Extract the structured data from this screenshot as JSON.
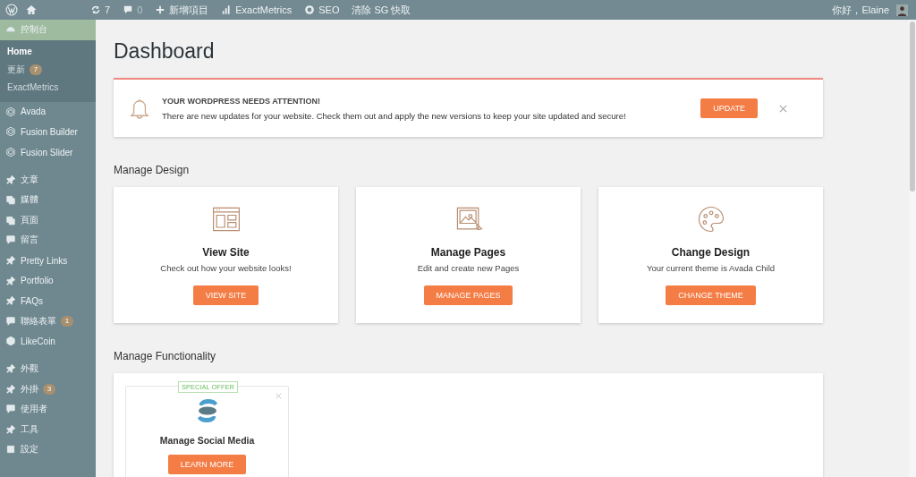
{
  "admin_bar": {
    "updates": "7",
    "comments": "0",
    "new_label": "新增項目",
    "analytics_label": "ExactMetrics",
    "seo_label": "SEO",
    "cache_label": "清除 SG 快取",
    "greeting": "你好，Elaine"
  },
  "sidebar": {
    "groups": [
      {
        "items": [
          {
            "label": "控制台",
            "selected": true,
            "submenu": [
              {
                "label": "Home",
                "selected": true
              },
              {
                "label": "更新",
                "selected": false,
                "badge": "7"
              },
              {
                "label": "ExactMetrics",
                "selected": false
              }
            ]
          }
        ]
      },
      {
        "items": [
          {
            "label": "Avada",
            "selected": false
          },
          {
            "label": "Fusion Builder",
            "selected": false
          },
          {
            "label": "Fusion Slider",
            "selected": false
          }
        ]
      },
      {
        "items": [
          {
            "label": "文章",
            "selected": false
          },
          {
            "label": "媒體",
            "selected": false
          },
          {
            "label": "頁面",
            "selected": false
          },
          {
            "label": "留言",
            "selected": false
          },
          {
            "label": "Pretty Links",
            "selected": false
          },
          {
            "label": "Portfolio",
            "selected": false
          },
          {
            "label": "FAQs",
            "selected": false
          },
          {
            "label": "聯絡表單",
            "selected": false,
            "badge": "1"
          },
          {
            "label": "LikeCoin",
            "selected": false
          }
        ]
      },
      {
        "items": [
          {
            "label": "外觀",
            "selected": false
          },
          {
            "label": "外掛",
            "selected": false,
            "badge": "3"
          },
          {
            "label": "使用者",
            "selected": false
          },
          {
            "label": "工具",
            "selected": false
          },
          {
            "label": "設定",
            "selected": false
          }
        ]
      }
    ]
  },
  "page_title": "Dashboard",
  "notice": {
    "title": "YOUR WORDPRESS NEEDS ATTENTION!",
    "text": "There are new updates for your website. Check them out and apply the new versions to keep your site updated and secure!",
    "button": "UPDATE"
  },
  "sections": [
    {
      "title": "Manage Design",
      "cards": [
        {
          "kind": "site",
          "title": "View Site",
          "text": "Check out how your website looks!",
          "button": "VIEW SITE"
        },
        {
          "kind": "pages",
          "title": "Manage Pages",
          "text": "Edit and create new Pages",
          "button": "MANAGE PAGES"
        },
        {
          "kind": "design",
          "title": "Change Design",
          "text": "Your current theme is Avada Child",
          "button": "CHANGE THEME"
        }
      ]
    },
    {
      "title": "Manage Functionality",
      "offers": [
        {
          "badge": "SPECIAL OFFER",
          "title": "Manage Social Media",
          "button": "LEARN MORE"
        }
      ]
    }
  ]
}
